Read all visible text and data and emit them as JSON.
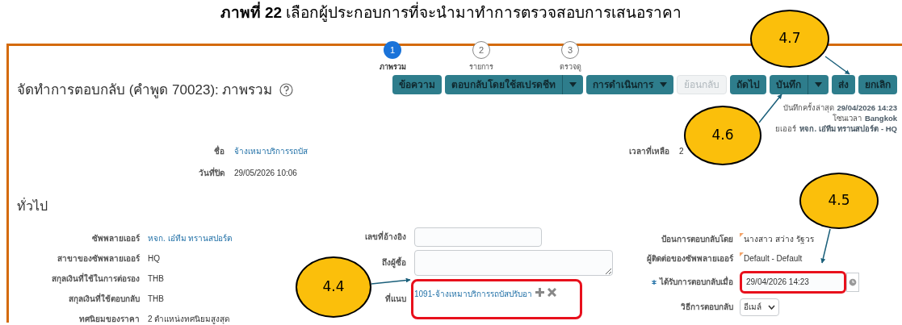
{
  "caption": "**ภาพที่ 22** เลือกผู้ประกอบการที่จะนำมาทำการตรวจสอบการเสนอราคา",
  "page_title": "จัดทำการตอบกลับ (คำพูด 70023): ภาพรวม",
  "steps": [
    {
      "number": "1",
      "label": "ภาพรวม",
      "selected": true
    },
    {
      "number": "2",
      "label": "รายการ",
      "selected": false
    },
    {
      "number": "3",
      "label": "ตรวจดู",
      "selected": false
    }
  ],
  "buttons": [
    {
      "label": "ข้อความ",
      "kind": "plain",
      "disabled": false
    },
    {
      "label": "ตอบกลับโดยใช้สเปรดชีท",
      "kind": "split",
      "disabled": false
    },
    {
      "label": "การดำเนินการ",
      "kind": "menu",
      "disabled": false
    },
    {
      "label": "ย้อนกลับ",
      "kind": "plain",
      "disabled": true
    },
    {
      "label": "ถัดไป",
      "kind": "plain",
      "disabled": false
    },
    {
      "label": "บันทึก",
      "kind": "split",
      "disabled": false
    },
    {
      "label": "ส่ง",
      "kind": "plain",
      "disabled": false
    },
    {
      "label": "ยกเลิก",
      "kind": "plain",
      "disabled": false
    }
  ],
  "info": [
    {
      "label": "บันทึกครั้งล่าสุด",
      "value": "29/04/2026 14:23"
    },
    {
      "label": "โซนเวลา",
      "value": "Bangkok"
    },
    {
      "label": "ยเออร์",
      "value": "หจก. เอ๋ทีม ทรานสปอร์ต - HQ"
    }
  ],
  "header_fields": [
    {
      "label": "ชื่อ",
      "value": "จ้างเหมาบริการรถบัส",
      "kind": "link"
    },
    {
      "label": "วันที่ปิด",
      "value": "29/05/2026 10:06",
      "kind": "text"
    }
  ],
  "time_left": {
    "label": "เวลาที่เหลือ",
    "value": "2"
  },
  "section_title": "ทั่วไป",
  "general_left": [
    {
      "label": "ซัพพลายเออร์",
      "value": "หจก. เอ๋ทีม ทรานสปอร์ต",
      "kind": "link"
    },
    {
      "label": "สาขาของซัพพลายเออร์",
      "value": "HQ",
      "kind": "text"
    },
    {
      "label": "สกุลเงินที่ใช้ในการต่อรอง",
      "value": "THB",
      "kind": "text"
    },
    {
      "label": "สกุลเงินที่ใช้ตอบกลับ",
      "value": "THB",
      "kind": "text"
    },
    {
      "label": "ทศนิยมของราคา",
      "value": "2 ตำแหน่งทศนิยมสูงสุด",
      "kind": "text"
    }
  ],
  "general_middle": [
    {
      "label": "เลขที่อ้างอิง",
      "kind": "input"
    },
    {
      "label": "ถึงผู้ซื้อ",
      "kind": "textarea"
    },
    {
      "label": "ที่แนบ",
      "kind": "attachment",
      "value": "1091-จ้างเหมาบริการรถบัสปรับอา"
    }
  ],
  "general_right": [
    {
      "label": "ป้อนการตอบกลับโดย",
      "value": "นางสาว สว่าง รัฐวร",
      "kind": "flagged",
      "required": false
    },
    {
      "label": "ผู้ติดต่อของซัพพลายเออร์",
      "value": "Default - Default",
      "kind": "flagged",
      "required": false
    },
    {
      "label": "ได้รับการตอบกลับเมื่อ",
      "value": "29/04/2026 14:23",
      "kind": "datetime",
      "required": true
    },
    {
      "label": "วิธีการตอบกลับ",
      "value": "อีเมล์",
      "kind": "select",
      "required": false
    }
  ],
  "callouts": [
    "4.7",
    "4.6",
    "4.5",
    "4.4"
  ]
}
